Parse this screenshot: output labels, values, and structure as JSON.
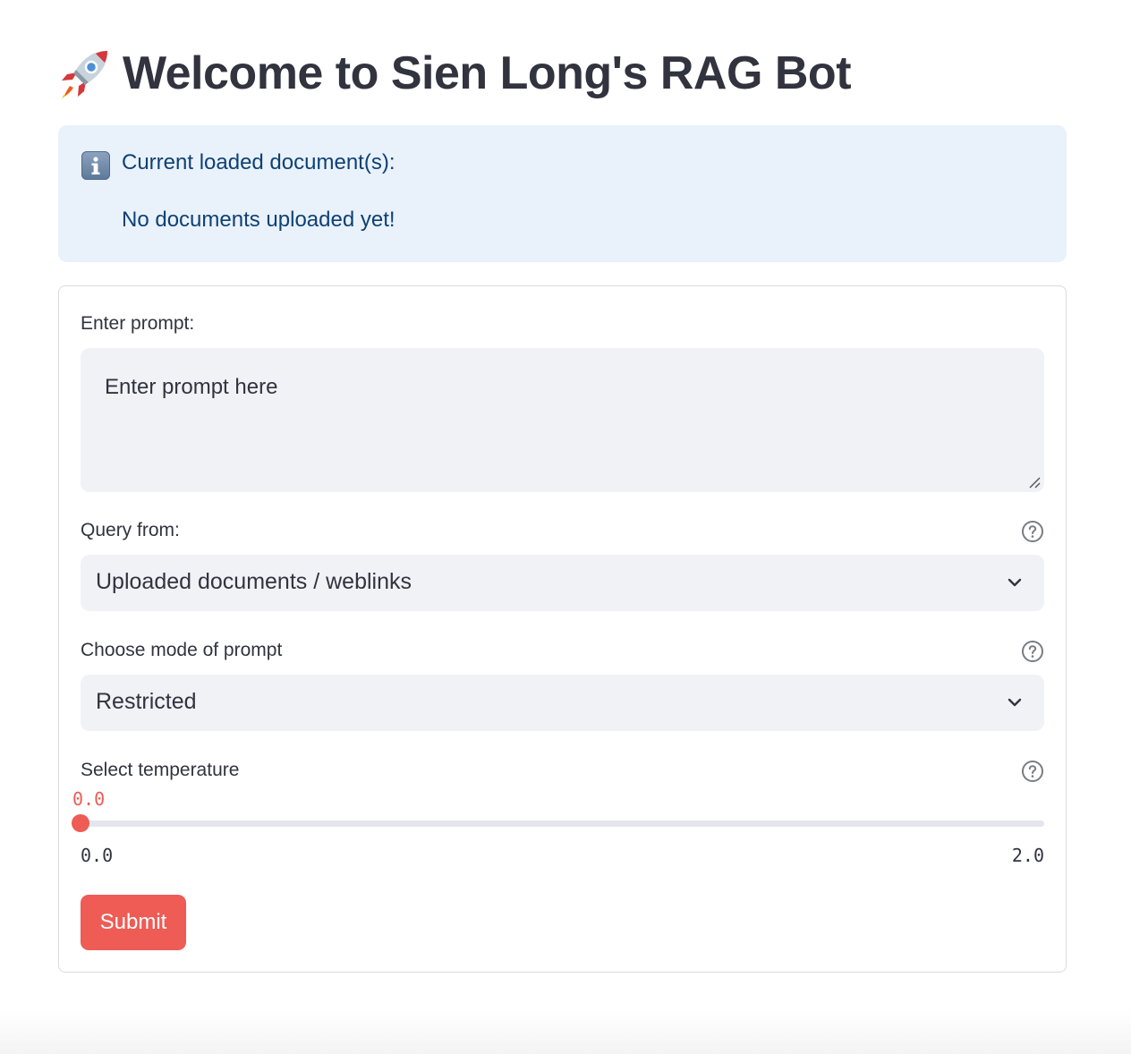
{
  "header": {
    "icon": "rocket-emoji",
    "title": "Welcome to Sien Long's RAG Bot"
  },
  "info": {
    "icon": "info-icon",
    "title": "Current loaded document(s):",
    "body": "No documents uploaded yet!"
  },
  "form": {
    "prompt": {
      "label": "Enter prompt:",
      "value": "",
      "placeholder": "Enter prompt here"
    },
    "query_from": {
      "label": "Query from:",
      "selected": "Uploaded documents / weblinks",
      "help_icon": "question-circle-icon"
    },
    "mode": {
      "label": "Choose mode of prompt",
      "selected": "Restricted",
      "help_icon": "question-circle-icon"
    },
    "temperature": {
      "label": "Select temperature",
      "current": "0.0",
      "min": "0.0",
      "max": "2.0",
      "value": 0.0,
      "help_icon": "question-circle-icon"
    },
    "submit_label": "Submit"
  },
  "colors": {
    "accent": "#ee5c55",
    "info_bg": "#e9f1fb",
    "info_text": "#0e4174",
    "input_bg": "#f0f2f6",
    "text": "#31333f"
  }
}
